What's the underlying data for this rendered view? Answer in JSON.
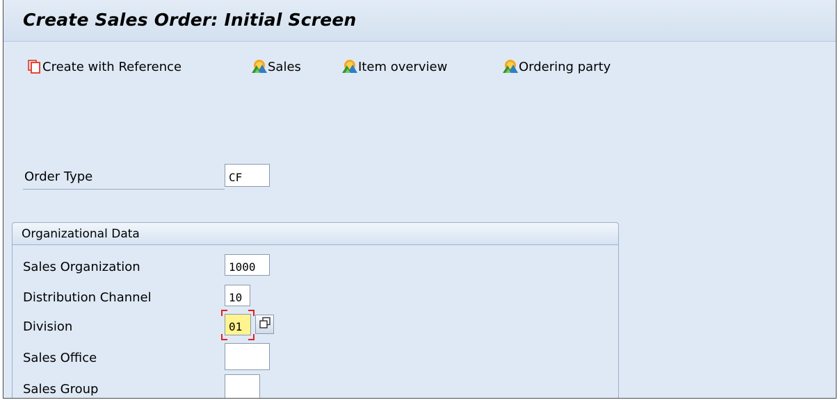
{
  "title": "Create Sales Order: Initial Screen",
  "toolbar": {
    "create_with_reference": "Create with Reference",
    "sales": "Sales",
    "item_overview": "Item overview",
    "ordering_party": "Ordering party"
  },
  "order_type": {
    "label": "Order Type",
    "value": "CF"
  },
  "org_data": {
    "title": "Organizational Data",
    "sales_organization": {
      "label": "Sales Organization",
      "value": "1000"
    },
    "distribution_channel": {
      "label": "Distribution Channel",
      "value": "10"
    },
    "division": {
      "label": "Division",
      "value": "01"
    },
    "sales_office": {
      "label": "Sales Office",
      "value": ""
    },
    "sales_group": {
      "label": "Sales Group",
      "value": ""
    }
  },
  "icons": {
    "create_with_reference": "copy-document-icon",
    "screen_nav": "mountain-sun-icon",
    "value_help": "possible-entries-icon"
  },
  "colors": {
    "background": "#dfe9f5",
    "field_focus": "#fff48f",
    "focus_marker": "#e02020",
    "reference_icon": "#e8331c"
  }
}
